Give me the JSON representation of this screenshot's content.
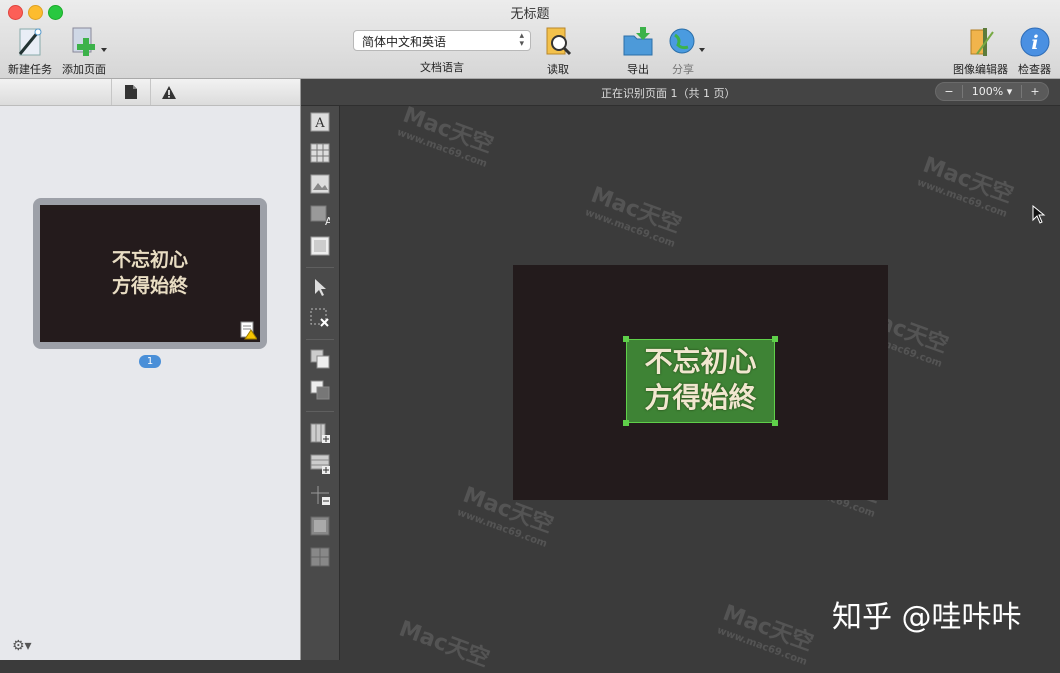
{
  "window": {
    "title": "无标题"
  },
  "toolbar": {
    "new_task": "新建任务",
    "add_page": "添加页面",
    "language_value": "简体中文和英语",
    "language_label": "文档语言",
    "read": "读取",
    "export": "导出",
    "share": "分享",
    "image_editor": "图像编辑器",
    "inspector": "检查器"
  },
  "sidebar": {
    "thumbnail_text_line1": "不忘初心",
    "thumbnail_text_line2": "方得始終",
    "page_number": "1"
  },
  "main": {
    "status": "正在识别页面 1（共 1 页）",
    "zoom_out": "−",
    "zoom_level": "100%",
    "zoom_in": "+",
    "doc_text_line1": "不忘初心",
    "doc_text_line2": "方得始終"
  },
  "watermark": {
    "text": "Mac天空",
    "url": "www.mac69.com"
  },
  "credit": "知乎 @哇咔咔",
  "colors": {
    "selection": "#4aa03c",
    "accent": "#4a8fd8"
  }
}
